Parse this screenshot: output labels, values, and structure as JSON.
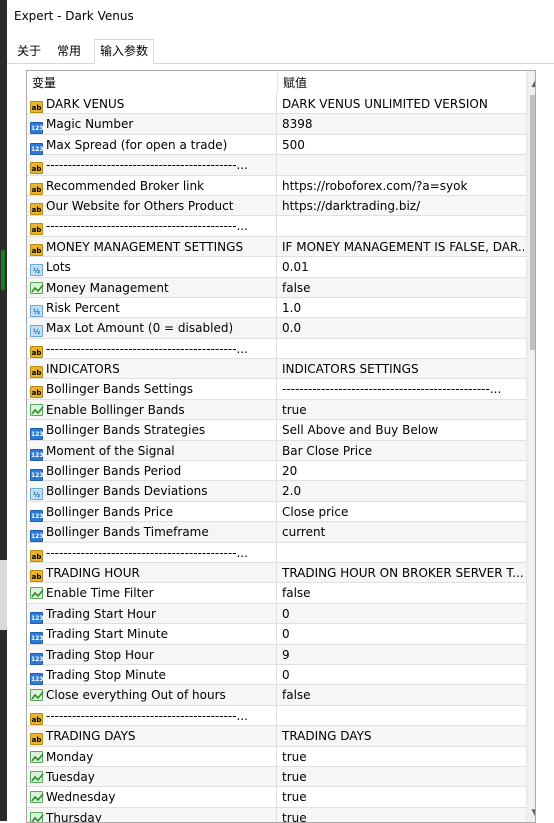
{
  "window": {
    "title": "Expert - Dark Venus"
  },
  "tabs": [
    {
      "label": "关于",
      "active": false
    },
    {
      "label": "常用",
      "active": false
    },
    {
      "label": "输入参数",
      "active": true
    }
  ],
  "table": {
    "columns": [
      "变量",
      "赋值"
    ],
    "rows": [
      {
        "icon": "ab",
        "name": "DARK VENUS",
        "value": "DARK VENUS UNLIMITED VERSION"
      },
      {
        "icon": "123",
        "name": "Magic Number",
        "value": "8398"
      },
      {
        "icon": "123",
        "name": "Max Spread (for open a trade)",
        "value": "500"
      },
      {
        "icon": "ab",
        "name": "--------------------------------------------...",
        "value": ""
      },
      {
        "icon": "ab",
        "name": "Recommended Broker link",
        "value": "https://roboforex.com/?a=syok"
      },
      {
        "icon": "ab",
        "name": "Our Website for Others Product",
        "value": "https://darktrading.biz/"
      },
      {
        "icon": "ab",
        "name": "--------------------------------------------...",
        "value": ""
      },
      {
        "icon": "ab",
        "name": "MONEY MANAGEMENT SETTINGS",
        "value": "IF MONEY MANAGEMENT IS FALSE, DAR..."
      },
      {
        "icon": "v2",
        "name": "Lots",
        "value": "0.01"
      },
      {
        "icon": "bool",
        "name": "Money Management",
        "value": "false"
      },
      {
        "icon": "v2",
        "name": "Risk Percent",
        "value": "1.0"
      },
      {
        "icon": "v2",
        "name": "Max Lot Amount (0 = disabled)",
        "value": "0.0"
      },
      {
        "icon": "ab",
        "name": "--------------------------------------------...",
        "value": ""
      },
      {
        "icon": "ab",
        "name": "INDICATORS",
        "value": "INDICATORS SETTINGS"
      },
      {
        "icon": "ab",
        "name": "Bollinger Bands Settings",
        "value": "------------------------------------------------..."
      },
      {
        "icon": "bool",
        "name": "Enable Bollinger Bands",
        "value": "true"
      },
      {
        "icon": "123",
        "name": "Bollinger Bands Strategies",
        "value": "Sell Above and Buy Below"
      },
      {
        "icon": "123",
        "name": "Moment of the Signal",
        "value": "Bar Close Price"
      },
      {
        "icon": "123",
        "name": "Bollinger Bands Period",
        "value": "20"
      },
      {
        "icon": "v2",
        "name": "Bollinger Bands Deviations",
        "value": "2.0"
      },
      {
        "icon": "123",
        "name": "Bollinger Bands Price",
        "value": "Close price"
      },
      {
        "icon": "123",
        "name": "Bollinger Bands Timeframe",
        "value": "current"
      },
      {
        "icon": "ab",
        "name": "--------------------------------------------...",
        "value": ""
      },
      {
        "icon": "ab",
        "name": "TRADING HOUR",
        "value": "TRADING HOUR ON BROKER SERVER T..."
      },
      {
        "icon": "bool",
        "name": "Enable Time Filter",
        "value": "false"
      },
      {
        "icon": "123",
        "name": "Trading Start Hour",
        "value": "0"
      },
      {
        "icon": "123",
        "name": "Trading Start Minute",
        "value": "0"
      },
      {
        "icon": "123",
        "name": "Trading Stop Hour",
        "value": "9"
      },
      {
        "icon": "123",
        "name": "Trading Stop Minute",
        "value": "0"
      },
      {
        "icon": "bool",
        "name": "Close everything Out of hours",
        "value": "false"
      },
      {
        "icon": "ab",
        "name": "--------------------------------------------...",
        "value": ""
      },
      {
        "icon": "ab",
        "name": "TRADING DAYS",
        "value": "TRADING DAYS"
      },
      {
        "icon": "bool",
        "name": "Monday",
        "value": "true"
      },
      {
        "icon": "bool",
        "name": "Tuesday",
        "value": "true"
      },
      {
        "icon": "bool",
        "name": "Wednesday",
        "value": "true"
      },
      {
        "icon": "bool",
        "name": "Thursday",
        "value": "true"
      }
    ]
  },
  "icon_labels": {
    "ab": "ab",
    "123": "123",
    "v2": "½"
  },
  "colors": {
    "ab_icon": "#e8b52b",
    "int_icon": "#2e7bd6",
    "double_icon": "#bfe0f5",
    "bool_icon": "#58a858"
  }
}
